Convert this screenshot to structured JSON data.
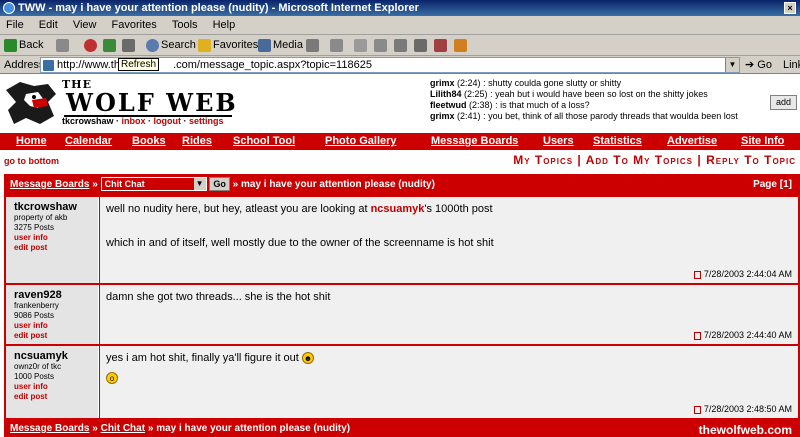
{
  "window": {
    "title": "TWW - may i have your attention please (nudity) - Microsoft Internet Explorer"
  },
  "menu": [
    "File",
    "Edit",
    "View",
    "Favorites",
    "Tools",
    "Help"
  ],
  "toolbar": {
    "back": "Back",
    "search": "Search",
    "favorites": "Favorites",
    "media": "Media"
  },
  "address": {
    "label": "Address",
    "url": "http://www.the",
    "url_rest": ".com/message_topic.aspx?topic=118625",
    "tooltip": "Refresh",
    "go": "Go",
    "links": "Links"
  },
  "site": {
    "logo_the": "THE",
    "logo_title": "WOLF WEB",
    "username": "tkcrowshaw",
    "links": [
      "inbox",
      "logout",
      "settings"
    ]
  },
  "chat": [
    {
      "user": "grimx",
      "time": "(2:24)",
      "text": ": shutty coulda gone slutty or shitty"
    },
    {
      "user": "Lilith84",
      "time": "(2:25)",
      "text": ": yeah but i would have been so lost on the shitty jokes"
    },
    {
      "user": "fleetwud",
      "time": "(2:38)",
      "text": ": is that much of a loss?"
    },
    {
      "user": "grimx",
      "time": "(2:41)",
      "text": ": you bet, think of all those parody threads that woulda been lost"
    }
  ],
  "chat_add": "add",
  "nav": [
    "Home",
    "Calendar",
    "Books",
    "Rides",
    "School Tool",
    "Photo Gallery",
    "Message Boards",
    "Users",
    "Statistics",
    "Advertise",
    "Site Info"
  ],
  "subbar": {
    "goto_bottom": "go to bottom",
    "my_topics": "My Topics",
    "add_to_my_topics": "Add To My Topics",
    "reply": "Reply To Topic"
  },
  "thread": {
    "boards_label": "Message Boards",
    "board": "Chit Chat",
    "go": "Go",
    "title": "may i have your attention please (nudity)",
    "page_label": "Page",
    "page": "[1]"
  },
  "posts": [
    {
      "author": "tkcrowshaw",
      "meta1": "property of akb",
      "meta2": "3275 Posts",
      "link1": "user info",
      "link2": "edit post",
      "line1_pre": "well no nudity here, but hey, atleast you are looking at ",
      "line1_hl": "ncsuamyk",
      "line1_post": "'s 1000th post",
      "line2": "which in and of itself, well mostly due to the owner of the screenname is hot shit",
      "date": "7/28/2003 2:44:04 AM"
    },
    {
      "author": "raven928",
      "meta1": "frankenberry",
      "meta2": "9086 Posts",
      "link1": "user info",
      "link2": "edit post",
      "line1": "damn she got two threads... she is the hot shit",
      "date": "7/28/2003 2:44:40 AM"
    },
    {
      "author": "ncsuamyk",
      "meta1": "ownz0r of tkc",
      "meta2": "1000 Posts",
      "link1": "user info",
      "link2": "edit post",
      "line1": "yes i am hot shit, finally ya'll figure it out",
      "date": "7/28/2003 2:48:50 AM"
    }
  ],
  "footer": {
    "boards_label": "Message Boards",
    "board": "Chit Chat",
    "title": "may i have your attention please (nudity)",
    "watermark": "thewolfweb.com"
  }
}
